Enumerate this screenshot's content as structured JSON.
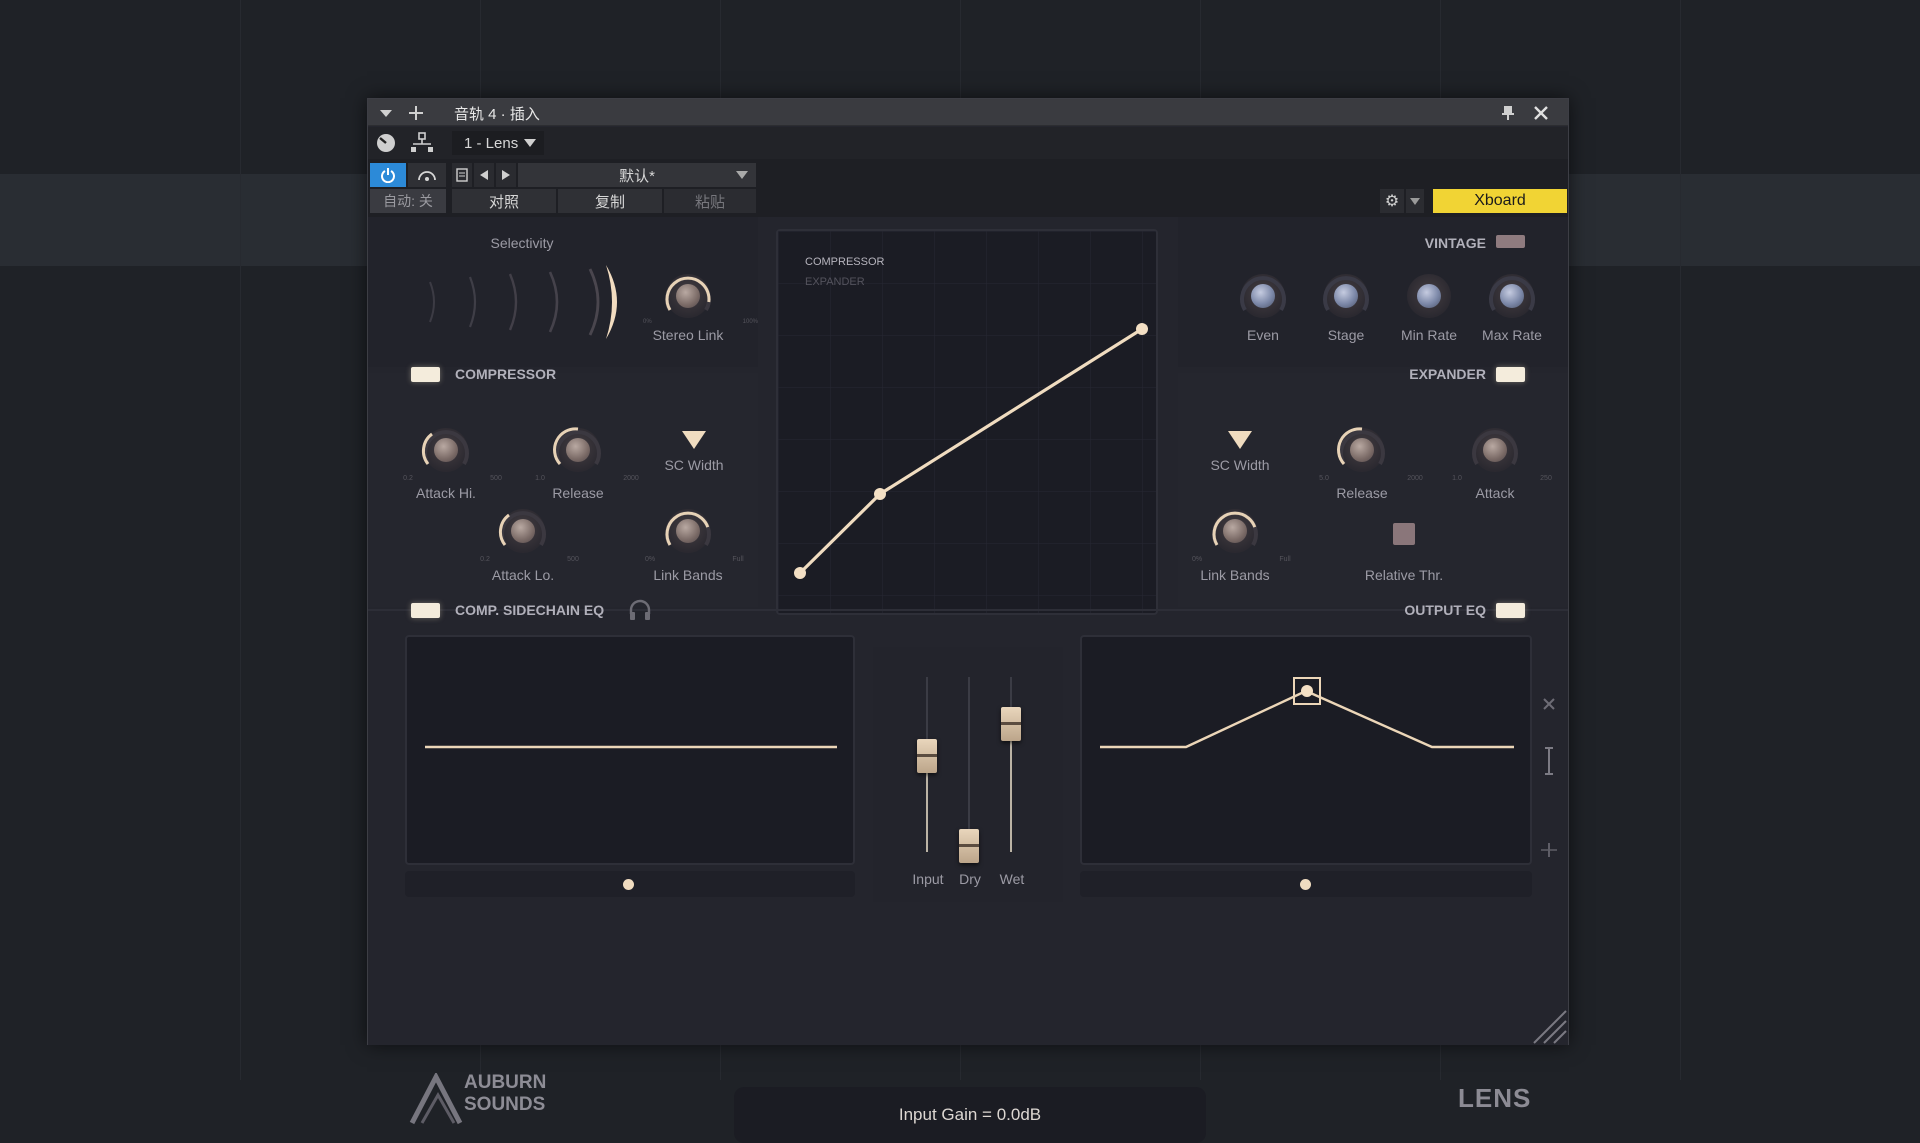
{
  "titlebar": {
    "title": "音轨 4 · 插入"
  },
  "toolbar": {
    "plugin_slot": "1 - Lens",
    "preset": "默认*",
    "auto_label": "自动: 关",
    "compare_label": "对照",
    "copy_label": "复制",
    "paste_label": "粘贴",
    "xboard_label": "Xboard"
  },
  "selectivity": {
    "label": "Selectivity"
  },
  "stereo_link": {
    "label": "Stereo Link",
    "min": "0%",
    "max": "100%"
  },
  "graph": {
    "mode_compressor": "COMPRESSOR",
    "mode_expander": "EXPANDER"
  },
  "vintage": {
    "label": "VINTAGE",
    "knobs": [
      "Even",
      "Stage",
      "Min Rate",
      "Max Rate"
    ]
  },
  "compressor": {
    "label": "COMPRESSOR",
    "attack_hi": "Attack Hi.",
    "attack_hi_min": "0.2",
    "attack_hi_max": "500",
    "release": "Release",
    "release_min": "1.0",
    "release_max": "2000",
    "sc_width": "SC Width",
    "attack_lo": "Attack Lo.",
    "attack_lo_min": "0.2",
    "attack_lo_max": "500",
    "link_bands": "Link Bands",
    "link_min": "0%",
    "link_max": "Full"
  },
  "expander": {
    "label": "EXPANDER",
    "sc_width": "SC Width",
    "release": "Release",
    "release_min": "5.0",
    "release_max": "2000",
    "attack": "Attack",
    "attack_min": "1.0",
    "attack_max": "250",
    "link_bands": "Link Bands",
    "link_min": "0%",
    "link_max": "Full",
    "relative_thr": "Relative Thr."
  },
  "sidechain_eq": {
    "label": "COMP. SIDECHAIN EQ"
  },
  "output_eq": {
    "label": "OUTPUT EQ"
  },
  "faders": {
    "input": "Input",
    "dry": "Dry",
    "wet": "Wet"
  },
  "status": {
    "text": "Input Gain = 0.0dB"
  },
  "brand": {
    "line1": "AUBURN",
    "line2": "SOUNDS",
    "product": "LENS"
  },
  "colors": {
    "accent": "#f4e2c6",
    "xboard": "#f1d434",
    "power": "#2f8fd8"
  }
}
